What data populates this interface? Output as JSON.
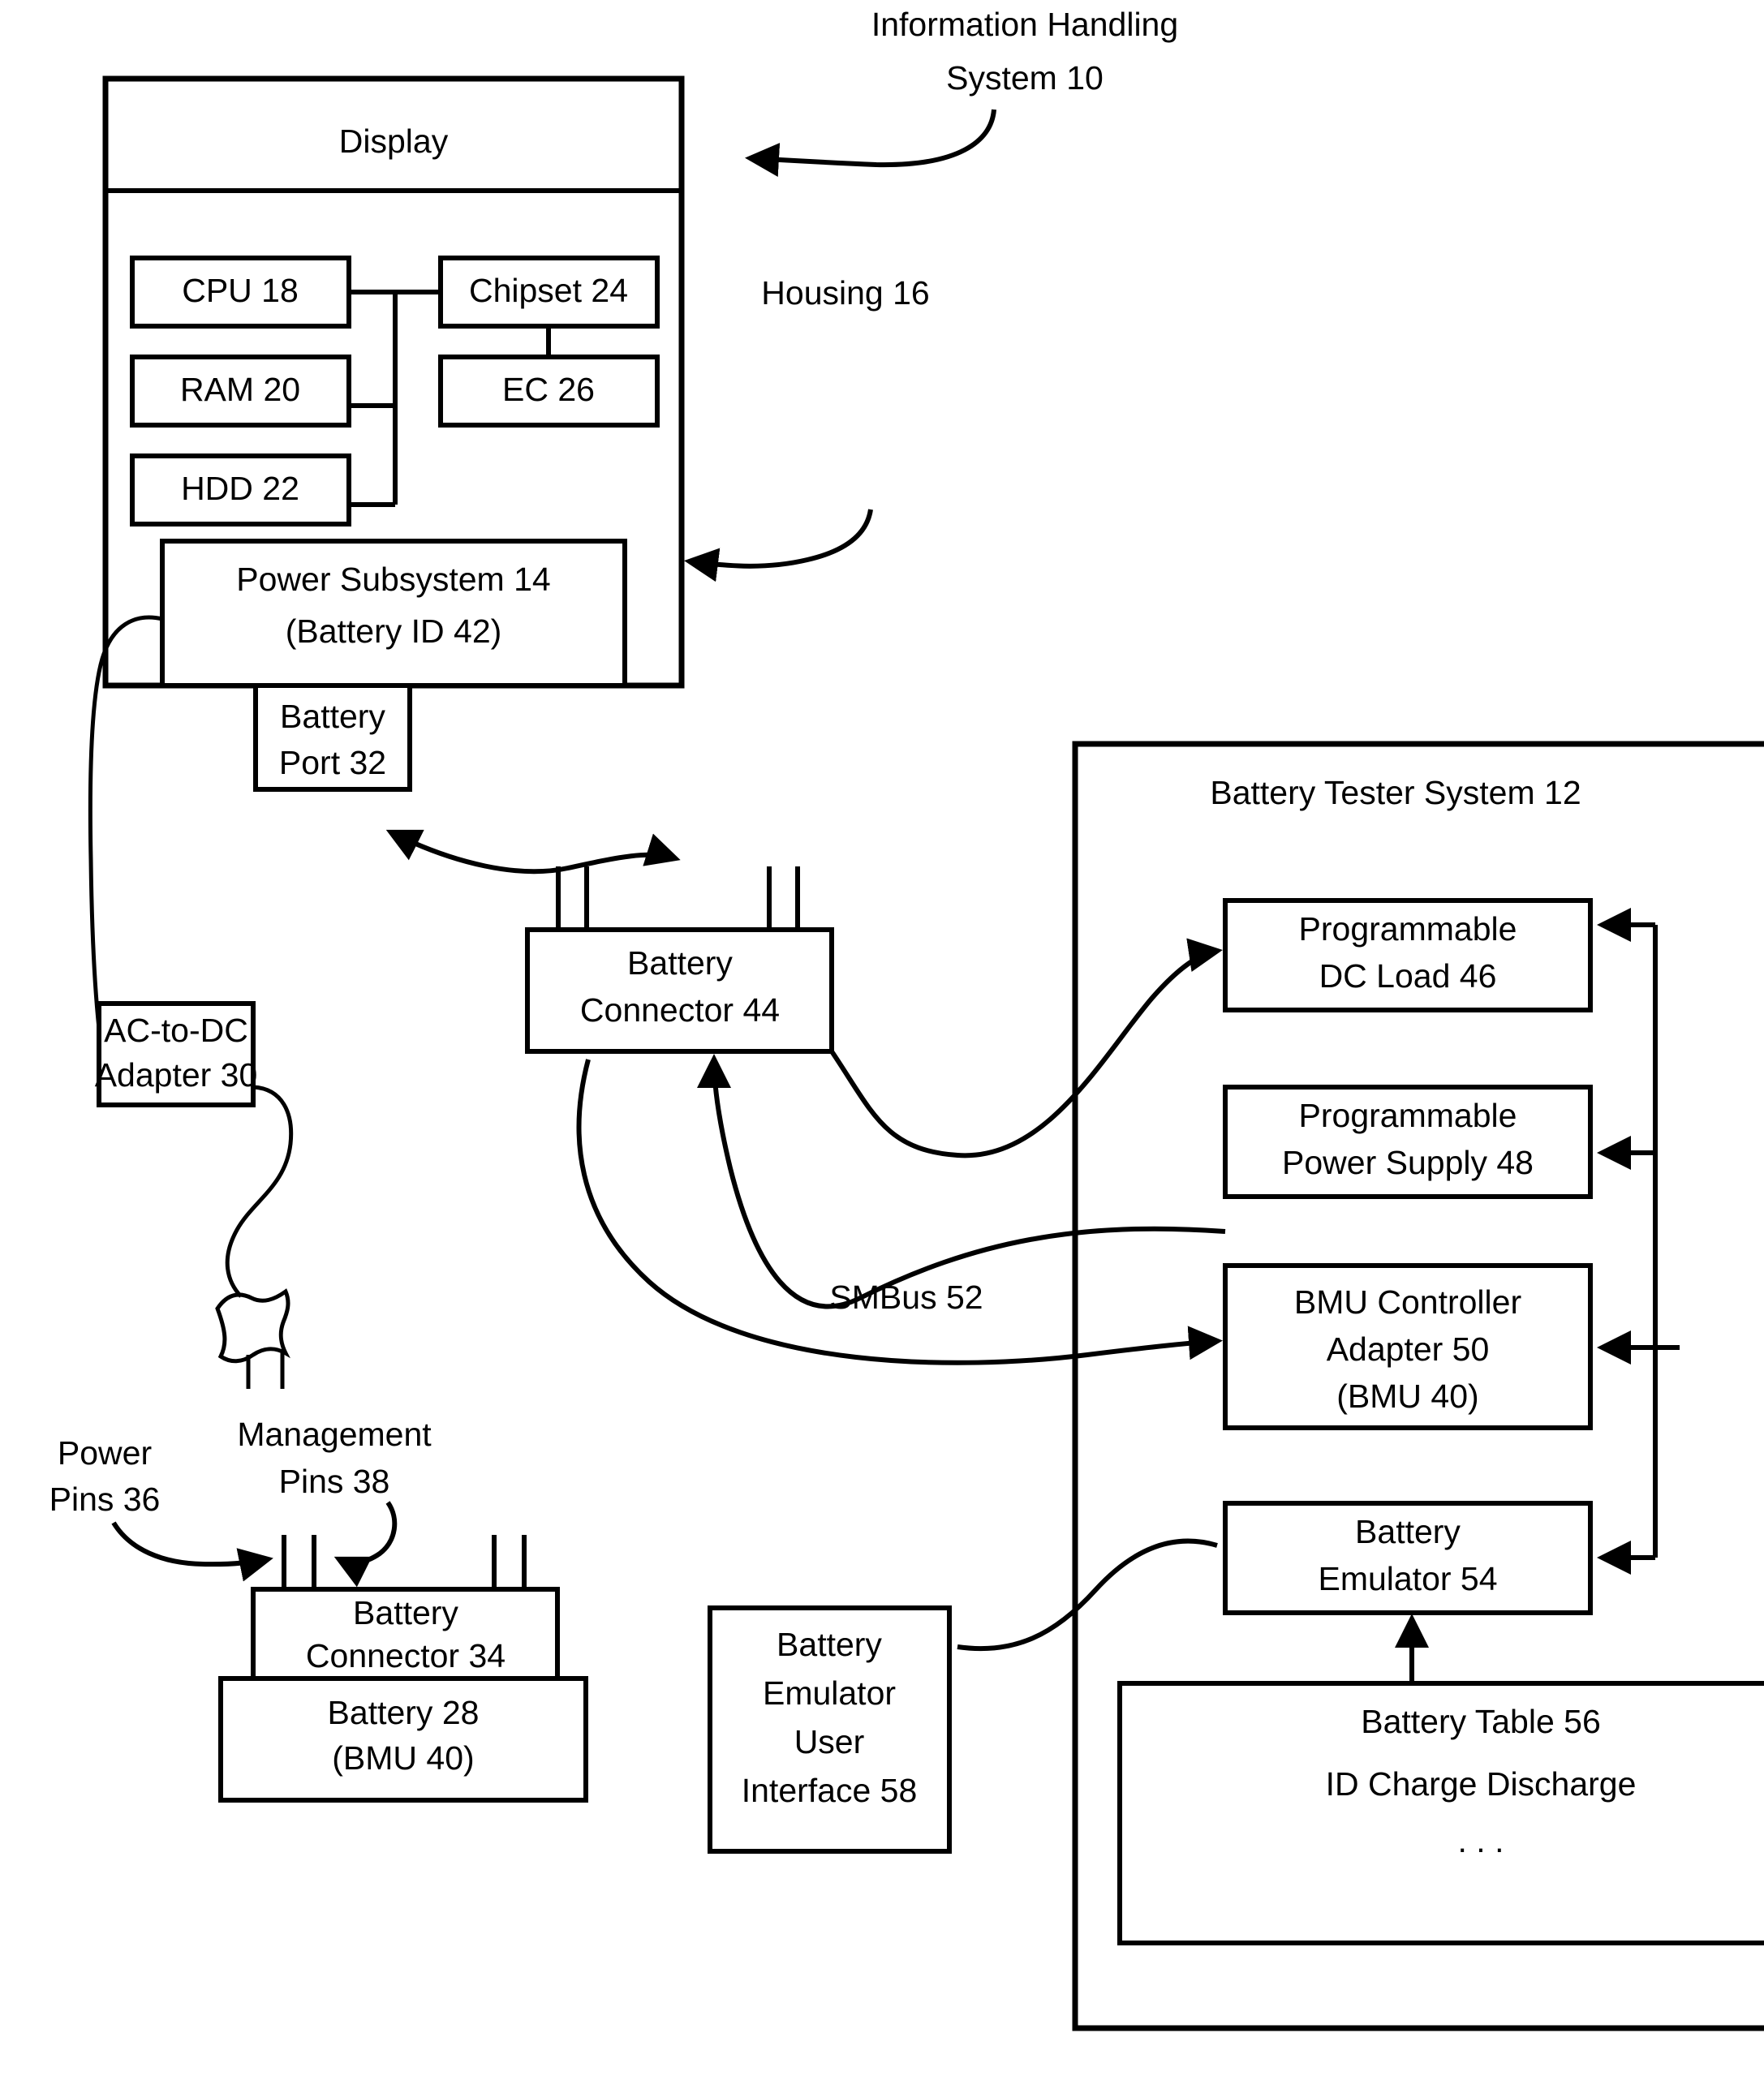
{
  "figure": {
    "title_callout": {
      "line1": "Information Handling",
      "line2": "System 10"
    },
    "housing_callout": "Housing 16",
    "smbus_label": "SMBus 52",
    "power_pins_callout": {
      "line1": "Power",
      "line2": "Pins 36"
    },
    "management_pins_callout": {
      "line1": "Management",
      "line2": "Pins 38"
    }
  },
  "information_handling_system": {
    "display": {
      "label": "Display"
    },
    "components": [
      {
        "id": "cpu",
        "label": "CPU 18"
      },
      {
        "id": "ram",
        "label": "RAM 20"
      },
      {
        "id": "hdd",
        "label": "HDD 22"
      },
      {
        "id": "chipset",
        "label": "Chipset 24"
      },
      {
        "id": "ec",
        "label": "EC 26"
      }
    ],
    "power_subsystem": {
      "line1": "Power Subsystem 14",
      "line2": "(Battery ID 42)"
    },
    "battery_port": {
      "line1": "Battery",
      "line2": "Port 32"
    }
  },
  "ac_adapter": {
    "line1": "AC-to-DC",
    "line2": "Adapter 30"
  },
  "battery_connector_44": {
    "line1": "Battery",
    "line2": "Connector 44"
  },
  "battery_assembly": {
    "connector": {
      "line1": "Battery",
      "line2": "Connector 34"
    },
    "battery": {
      "line1": "Battery 28",
      "line2": "(BMU 40)"
    }
  },
  "battery_emulator_ui": {
    "line1": "Battery",
    "line2": "Emulator",
    "line3": "User",
    "line4": "Interface 58"
  },
  "battery_tester_system": {
    "title": "Battery Tester System 12",
    "modules": [
      {
        "id": "dc-load",
        "line1": "Programmable",
        "line2": "DC Load 46",
        "line3": ""
      },
      {
        "id": "power-supply",
        "line1": "Programmable",
        "line2": "Power Supply 48",
        "line3": ""
      },
      {
        "id": "bmu-controller",
        "line1": "BMU Controller",
        "line2": "Adapter 50",
        "line3": "(BMU 40)"
      },
      {
        "id": "battery-emulator",
        "line1": "Battery",
        "line2": "Emulator 54",
        "line3": ""
      }
    ],
    "battery_table": {
      "title": "Battery Table 56",
      "columns": "ID  Charge  Discharge",
      "ellipsis": ". . ."
    }
  },
  "colors": {
    "ink": "#000000",
    "paper": "#ffffff"
  }
}
